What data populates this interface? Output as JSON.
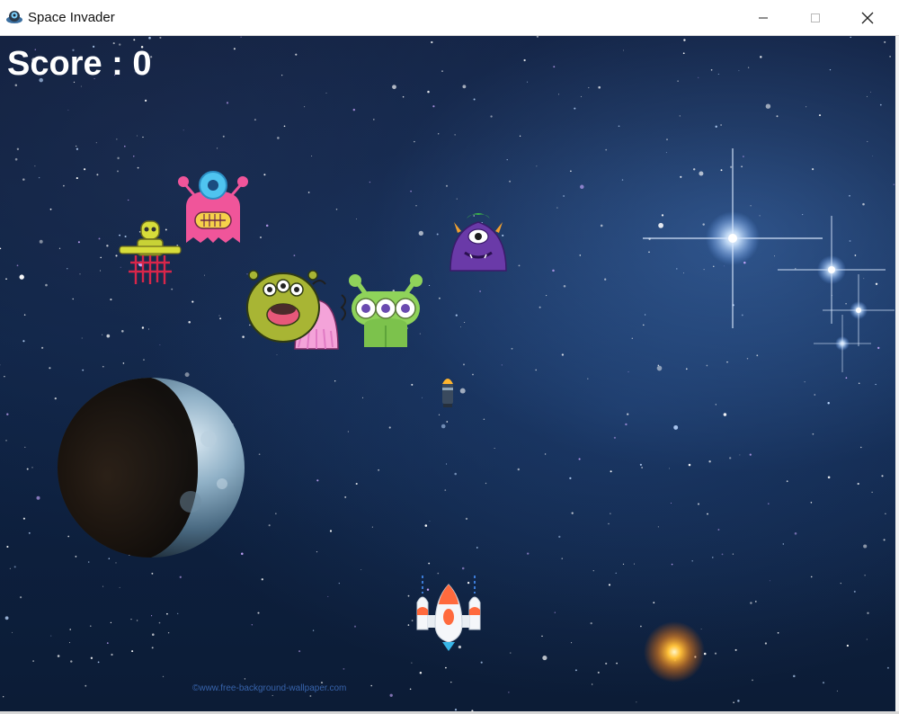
{
  "window": {
    "title": "Space Invader",
    "icon": "alien-ufo-icon",
    "controls": [
      "minimize-icon",
      "maximize-icon",
      "close-icon"
    ]
  },
  "hud": {
    "score_text": "Score : 0"
  },
  "scene": {
    "background": "starfield-nebula",
    "planet": "moon-planet",
    "sun_glow": "orange-star",
    "watermark": "©www.free-background-wallpaper.com"
  },
  "enemies": [
    {
      "name": "enemy-yellow-robot",
      "color": "#d7dd3a"
    },
    {
      "name": "enemy-pink-cyclops",
      "color": "#f0559a"
    },
    {
      "name": "enemy-purple-horned",
      "color": "#6a3aa8"
    },
    {
      "name": "enemy-olive-three-eyed",
      "color": "#a8b534"
    },
    {
      "name": "enemy-pink-squid",
      "color": "#f4a3d9"
    },
    {
      "name": "enemy-green-three-eyed",
      "color": "#8fd35a"
    }
  ],
  "player": {
    "name": "player-spaceship",
    "color": "#ff6a3d"
  },
  "bullet": {
    "name": "bullet",
    "color": "#ffb52e"
  }
}
